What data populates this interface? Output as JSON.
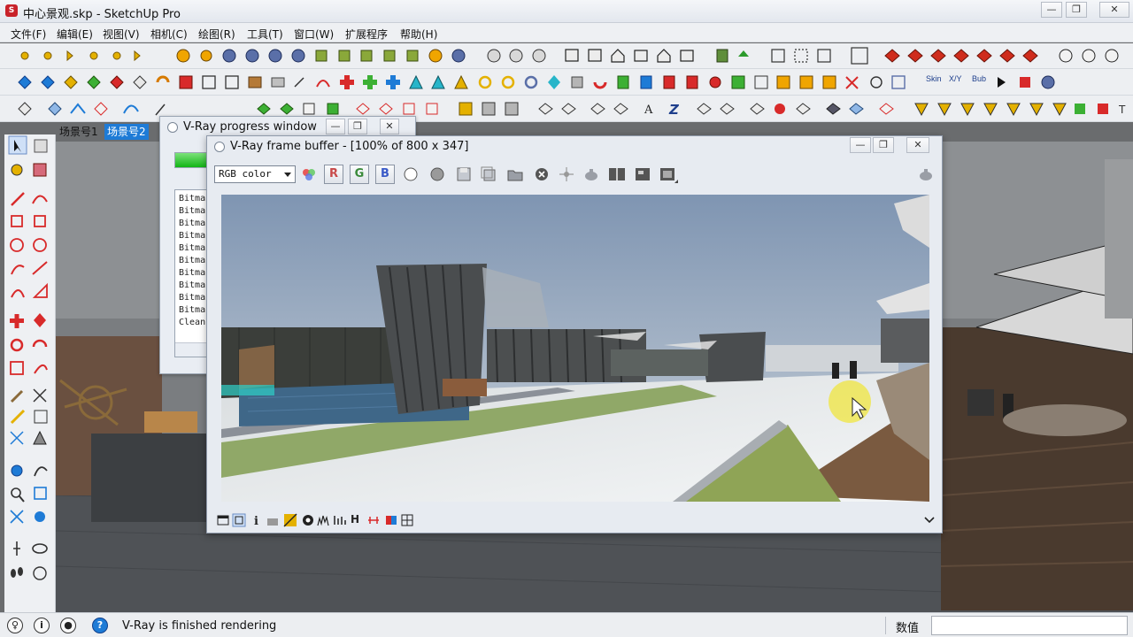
{
  "app": {
    "title": "中心景观.skp - SketchUp Pro",
    "icon": "sketchup-logo-icon",
    "window_controls": {
      "minimize": "—",
      "restore": "❐",
      "close": "✕"
    }
  },
  "menu": [
    "文件(F)",
    "编辑(E)",
    "视图(V)",
    "相机(C)",
    "绘图(R)",
    "工具(T)",
    "窗口(W)",
    "扩展程序",
    "帮助(H)"
  ],
  "scene_tabs": [
    {
      "label": "场景号1",
      "active": false
    },
    {
      "label": "场景号2",
      "active": true
    }
  ],
  "vray_progress": {
    "title": "V-Ray progress window",
    "progress_percent": 100,
    "log_lines": [
      "Bitma",
      "Bitma",
      "Bitma",
      "Bitma",
      "Bitma",
      "Bitma",
      "Bitma",
      "Bitma",
      "Bitma",
      "Bitma",
      "Clean"
    ]
  },
  "vfb": {
    "title": "V-Ray frame buffer - [100% of 800 x 347]",
    "channel": "RGB color",
    "channel_buttons": {
      "r": "R",
      "g": "G",
      "b": "B"
    },
    "bottom_h_label": "H"
  },
  "status": {
    "text": "V-Ray is finished rendering",
    "measurements_label": "数值",
    "measurements_value": ""
  },
  "colors": {
    "accent": "#1e7bd6",
    "progress_green": "#12b515",
    "sketchup_red": "#c8222a"
  }
}
